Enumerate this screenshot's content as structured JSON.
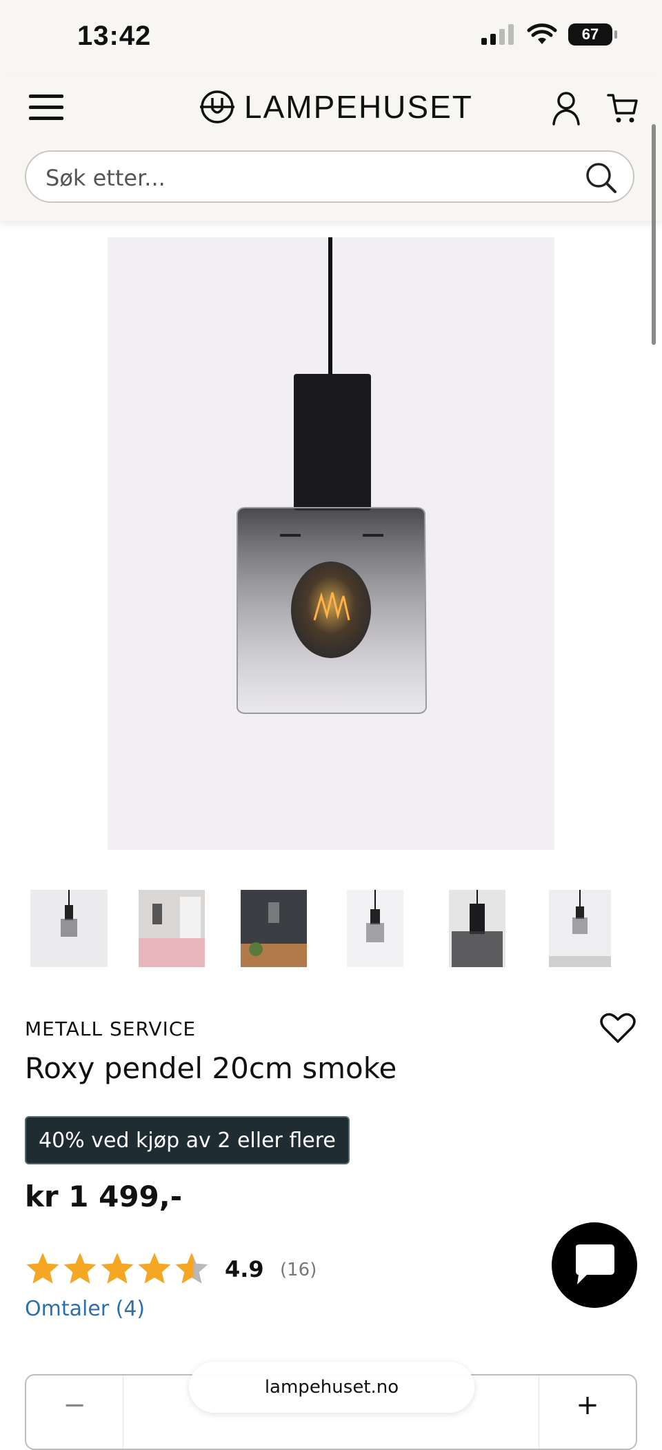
{
  "status": {
    "time": "13:42",
    "battery": "67"
  },
  "header": {
    "logo_text": "LAMPEHUSET"
  },
  "search": {
    "placeholder": "Søk etter..."
  },
  "gallery": {
    "thumbnail_count": 6
  },
  "product": {
    "brand": "METALL SERVICE",
    "title": "Roxy pendel 20cm smoke",
    "promo": "40% ved kjøp av 2 eller flere",
    "price": "kr 1 499,-",
    "rating": {
      "value": "4.9",
      "count": "(16)",
      "stars": 4.9
    },
    "reviews_link": "Omtaler (4)"
  },
  "quantity": {
    "minus": "−",
    "plus": "+"
  },
  "browser": {
    "url": "lampehuset.no"
  },
  "colors": {
    "promo_bg": "#1f2d33",
    "star": "#f5a623",
    "link": "#2f6fa8",
    "header_bg": "#f8f6f2"
  }
}
